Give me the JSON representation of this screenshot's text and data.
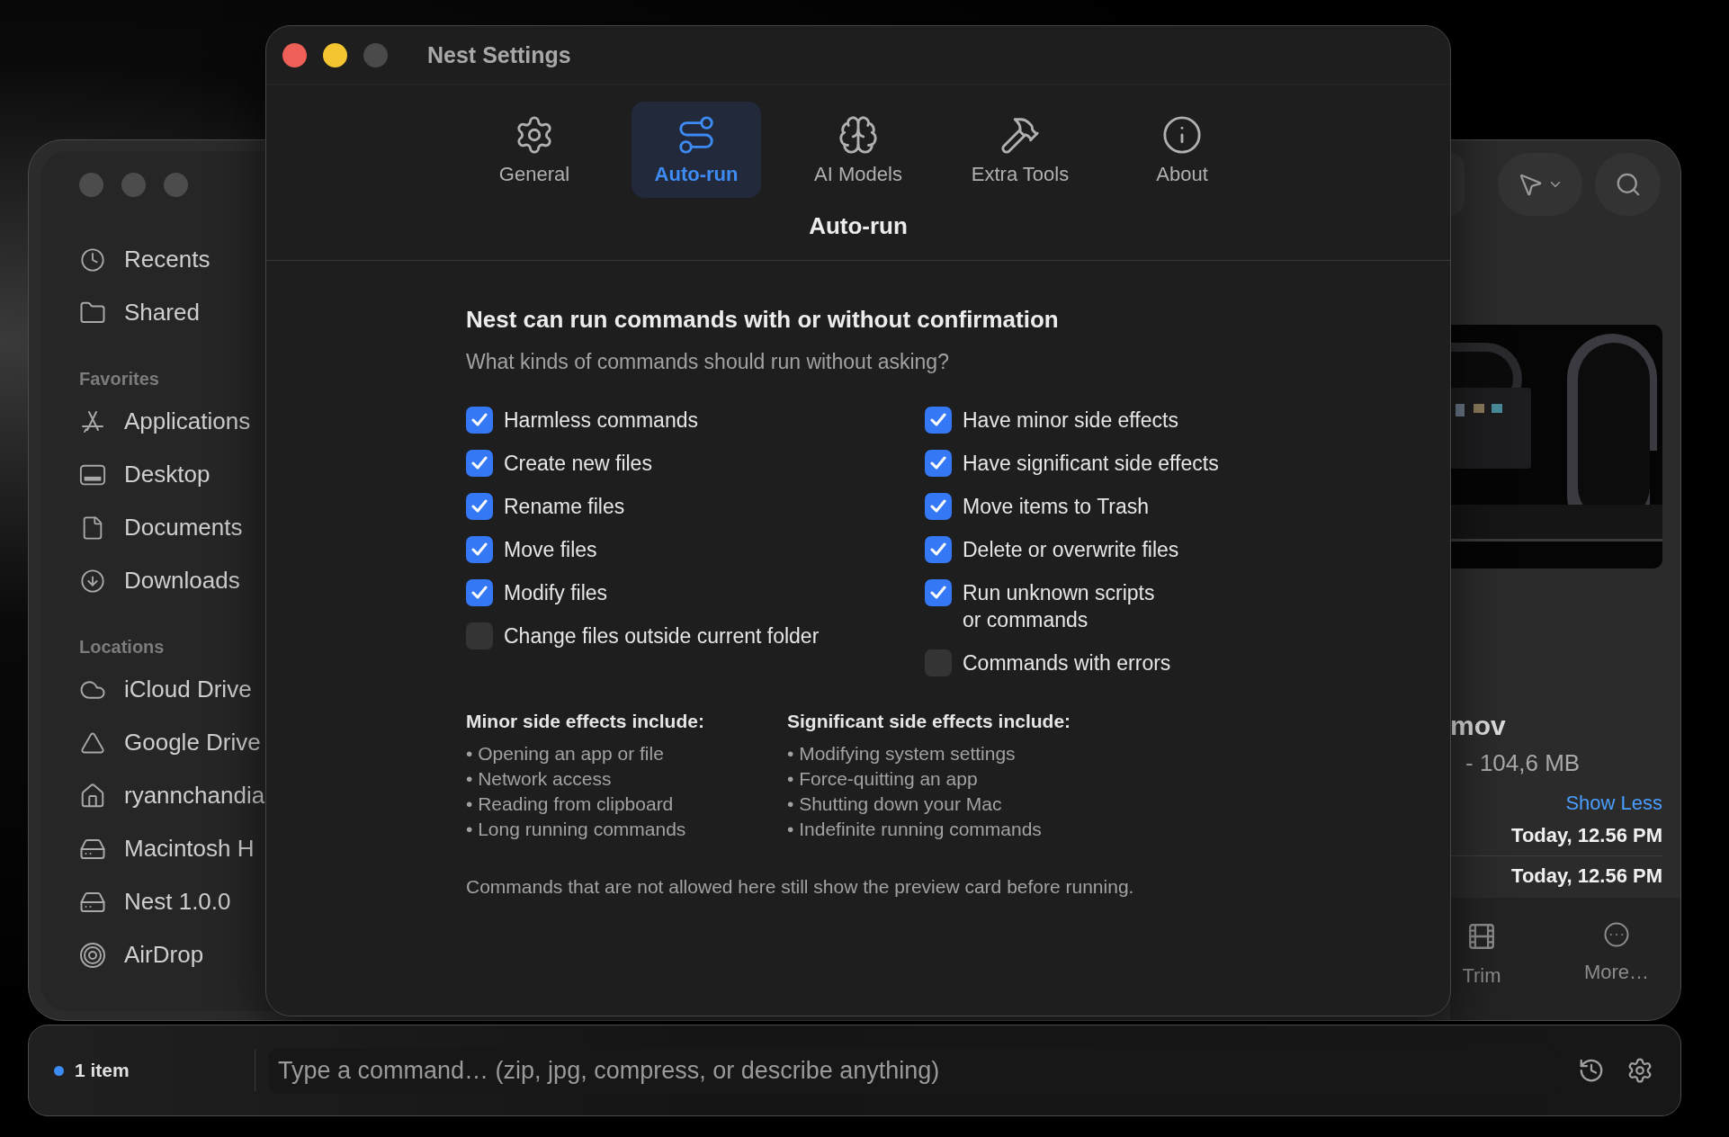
{
  "finder": {
    "sidebar": {
      "top_items": [
        {
          "label": "Recents"
        },
        {
          "label": "Shared"
        }
      ],
      "sections": [
        {
          "title": "Favorites",
          "items": [
            {
              "label": "Applications"
            },
            {
              "label": "Desktop"
            },
            {
              "label": "Documents"
            },
            {
              "label": "Downloads"
            }
          ]
        },
        {
          "title": "Locations",
          "items": [
            {
              "label": "iCloud Drive"
            },
            {
              "label": "Google Drive"
            },
            {
              "label": "ryannchandia"
            },
            {
              "label": "Macintosh H"
            },
            {
              "label": "Nest 1.0.0"
            },
            {
              "label": "AirDrop"
            }
          ]
        }
      ]
    },
    "info": {
      "file_name": "mov",
      "file_size": "- 104,6 MB",
      "toggle_link": "Show Less",
      "dates": [
        "Today, 12.56 PM",
        "Today, 12.56 PM"
      ],
      "actions": [
        {
          "label": "Trim"
        },
        {
          "label": "More…"
        }
      ]
    }
  },
  "settings": {
    "title": "Nest Settings",
    "tabs": [
      {
        "label": "General",
        "selected": false
      },
      {
        "label": "Auto-run",
        "selected": true
      },
      {
        "label": "AI Models",
        "selected": false
      },
      {
        "label": "Extra Tools",
        "selected": false
      },
      {
        "label": "About",
        "selected": false
      }
    ],
    "page_title": "Auto-run",
    "heading": "Nest can run commands with or without confirmation",
    "question": "What kinds of commands should run without asking?",
    "options_left": [
      {
        "label": "Harmless commands",
        "checked": true
      },
      {
        "label": "Create new files",
        "checked": true
      },
      {
        "label": "Rename files",
        "checked": true
      },
      {
        "label": "Move files",
        "checked": true
      },
      {
        "label": "Modify files",
        "checked": true
      },
      {
        "label": "Change files outside current folder",
        "checked": false
      }
    ],
    "options_right": [
      {
        "label": "Have minor side effects",
        "checked": true
      },
      {
        "label": "Have significant side effects",
        "checked": true
      },
      {
        "label": "Move items to Trash",
        "checked": true
      },
      {
        "label": "Delete or overwrite files",
        "checked": true
      },
      {
        "label": "Run unknown scripts\nor commands",
        "checked": true
      },
      {
        "label": "Commands with errors",
        "checked": false
      }
    ],
    "notes": [
      {
        "title": "Minor side effects include:",
        "items": [
          "• Opening an app or file",
          "• Network access",
          "• Reading from clipboard",
          "• Long running commands"
        ]
      },
      {
        "title": "Significant side effects include:",
        "items": [
          "• Modifying system settings",
          "• Force-quitting an app",
          "• Shutting down your Mac",
          "• Indefinite running commands"
        ]
      }
    ],
    "footer": "Commands that are not allowed here still show the preview card before running."
  },
  "command_bar": {
    "item_count": "1 item",
    "placeholder": "Type a command… (zip, jpg, compress, or describe anything)"
  }
}
